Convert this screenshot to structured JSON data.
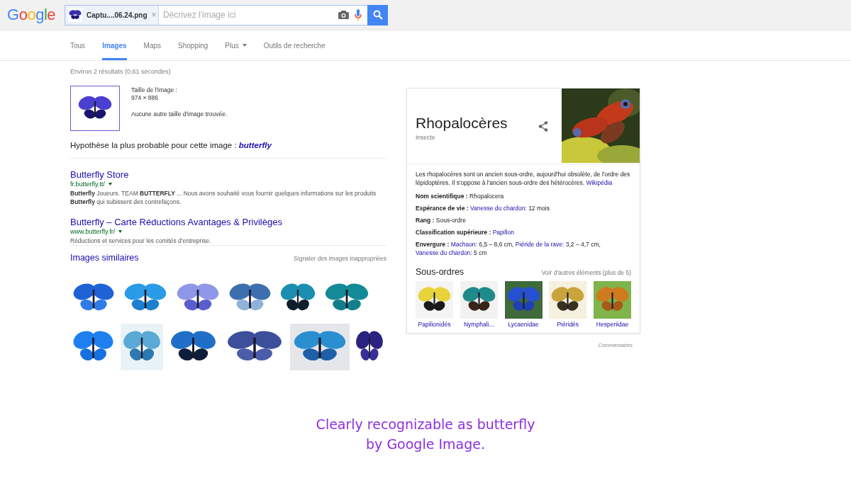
{
  "header": {
    "logo": "Google",
    "chip": {
      "filename": "Captu....06.24.png",
      "remove": "×"
    },
    "search": {
      "placeholder": "Décrivez l'image ici"
    }
  },
  "tabs": [
    {
      "label": "Tous",
      "selected": false,
      "dropdown": false
    },
    {
      "label": "Images",
      "selected": true,
      "dropdown": false
    },
    {
      "label": "Maps",
      "selected": false,
      "dropdown": false
    },
    {
      "label": "Shopping",
      "selected": false,
      "dropdown": false
    },
    {
      "label": "Plus",
      "selected": false,
      "dropdown": true
    },
    {
      "label": "Outils de recherche",
      "selected": false,
      "dropdown": false
    }
  ],
  "stats": "Environ 2 résultats (0,61 secondes)",
  "image_info": {
    "size_label": "Taille de l'image :",
    "size": "974 × 886",
    "note": "Aucune autre taille d'image trouvée."
  },
  "best_guess": {
    "text": "Hypothèse la plus probable pour cette image :",
    "guess": "butterfly"
  },
  "results": [
    {
      "title": "Butterfly Store",
      "url": "fr.butterfly.tt/",
      "snippet": "**Butterfly** Joueurs. TEAM **BUTTERFLY** ... Nous avons souhaité vous fournir quelques informations sur les produits **Butterfly** qui subissent des contrefaçons."
    },
    {
      "title": "Butterfly – Carte Réductions Avantages & Privilèges",
      "url": "www.butterfly.fr/",
      "snippet": "Réductions et services pour les comités d'entreprise."
    }
  ],
  "similar": {
    "title": "Images similaires",
    "report": "Signaler des images inappropriées"
  },
  "panel": {
    "title": "Rhopalocères",
    "subtitle": "Insecte",
    "description": "Les rhopalocères sont un ancien sous-ordre, aujourd'hui obsolète, de l'ordre des lépidoptères. Il s'oppose à l'ancien sous-ordre des hétérocères.",
    "source": "Wikipédia",
    "facts": [
      {
        "label": "Nom scientifique :",
        "value": [
          {
            "kind": "text",
            "text": "Rhopalocera"
          }
        ]
      },
      {
        "label": "Espérance de vie :",
        "value": [
          {
            "kind": "link",
            "text": "Vanesse du chardon:"
          },
          {
            "kind": "text",
            "text": "12 mois"
          }
        ]
      },
      {
        "label": "Rang :",
        "value": [
          {
            "kind": "text",
            "text": "Sous-ordre"
          }
        ]
      },
      {
        "label": "Classification supérieure :",
        "value": [
          {
            "kind": "link",
            "text": "Papillon"
          }
        ]
      },
      {
        "label": "Envergure :",
        "value": [
          {
            "kind": "link",
            "text": "Machaon:"
          },
          {
            "kind": "text",
            "text": "6,5 – 8,6 cm,"
          },
          {
            "kind": "link",
            "text": "Piéride de la rave:"
          },
          {
            "kind": "text",
            "text": "3,2 – 4,7 cm,"
          },
          {
            "kind": "link",
            "text": "Vanesse du chardon:"
          },
          {
            "kind": "text",
            "text": "5 cm"
          }
        ]
      }
    ],
    "suborders": {
      "title": "Sous-ordres",
      "more": "Voir d'autres éléments (plus de 5)",
      "items": [
        {
          "label": "Papilionidés"
        },
        {
          "label": "Nymphali..."
        },
        {
          "label": "Lycaenidae"
        },
        {
          "label": "Piéridés"
        },
        {
          "label": "Hesperiidae"
        }
      ]
    }
  },
  "feedback": "Commentaires",
  "caption": [
    "Clearly recognizable as butterfly",
    "by Google Image."
  ]
}
